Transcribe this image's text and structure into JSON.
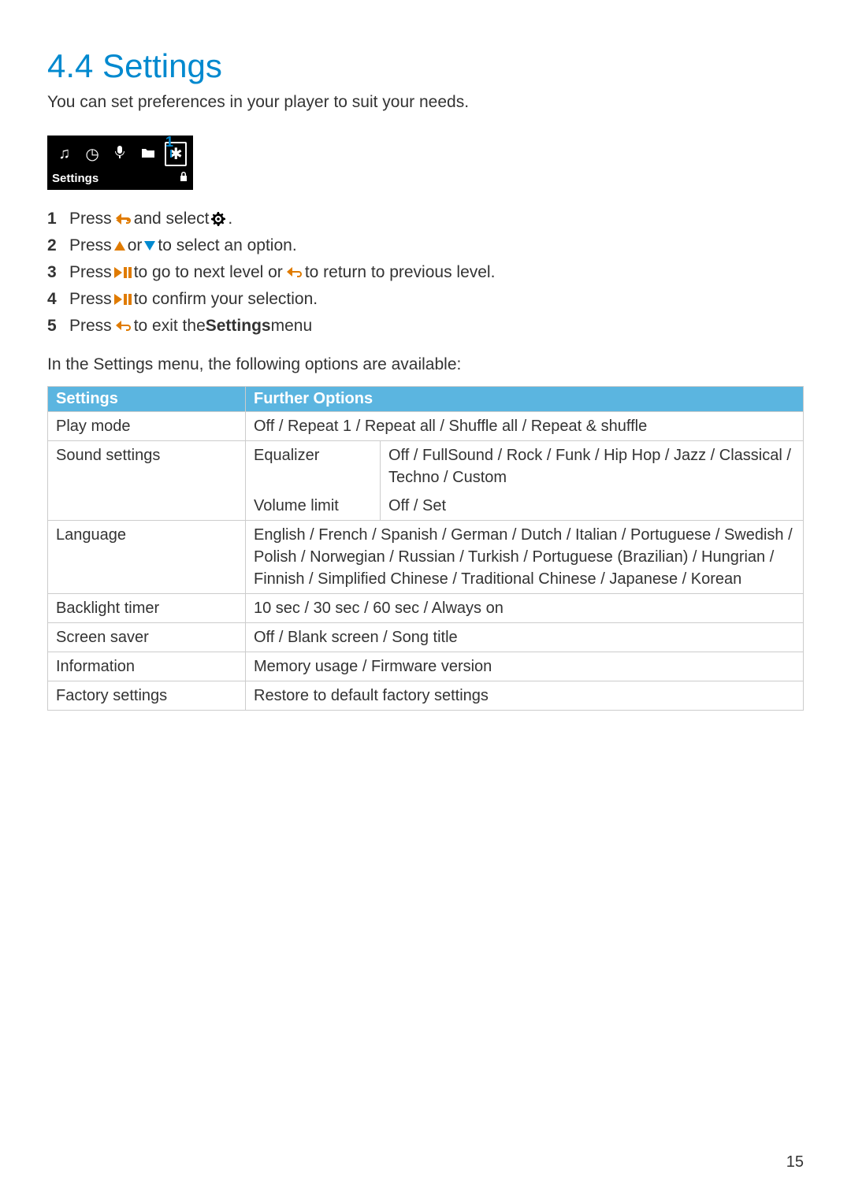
{
  "heading": "4.4  Settings",
  "intro": "You can set preferences in your player to suit your needs.",
  "figure": {
    "callout": "1",
    "icons": [
      "music-note-icon",
      "clock-icon",
      "microphone-icon",
      "folder-icon",
      "gear-icon"
    ],
    "label": "Settings",
    "lock": "lock-icon"
  },
  "steps": [
    {
      "pre": "Press ",
      "icon1": "back",
      "mid": " and select ",
      "icon2": "gear",
      "post": "."
    },
    {
      "pre": "Press ",
      "icon1": "up",
      "mid": " or ",
      "icon2": "down",
      "post": " to select an option."
    },
    {
      "pre": "Press ",
      "icon1": "playpause",
      "mid": " to go to next level or ",
      "icon2": "back",
      "post": " to return to previous level."
    },
    {
      "pre": "Press ",
      "icon1": "playpause",
      "mid": " to confirm your selection.",
      "icon2": "",
      "post": ""
    },
    {
      "pre": "Press ",
      "icon1": "back",
      "mid": " to exit the ",
      "bold": "Settings",
      "post": " menu"
    }
  ],
  "sub_intro": "In the Settings menu, the following options are available:",
  "table": {
    "headers": [
      "Settings",
      "Further Options"
    ],
    "rows": [
      {
        "setting": "Play mode",
        "sub": "",
        "opts": "Off / Repeat 1 / Repeat all / Shuffle all / Repeat & shuffle"
      },
      {
        "setting": "Sound settings",
        "sub": "Equalizer",
        "opts": "Off / FullSound / Rock / Funk / Hip Hop / Jazz / Classical / Techno / Custom"
      },
      {
        "setting": "",
        "sub": "Volume limit",
        "opts": "Off / Set"
      },
      {
        "setting": "Language",
        "sub": "",
        "opts": "English / French / Spanish / German / Dutch / Italian / Portuguese / Swedish / Polish / Norwegian / Russian / Turkish / Portuguese (Brazilian) / Hungrian / Finnish / Simplified Chinese / Traditional Chinese / Japanese / Korean"
      },
      {
        "setting": "Backlight timer",
        "sub": "",
        "opts": "10 sec / 30 sec / 60 sec / Always on"
      },
      {
        "setting": "Screen saver",
        "sub": "",
        "opts": "Off / Blank screen / Song title"
      },
      {
        "setting": "Information",
        "sub": "",
        "opts": "Memory usage / Firmware version"
      },
      {
        "setting": "Factory settings",
        "sub": "",
        "opts": "Restore to default factory settings"
      }
    ]
  },
  "page_number": "15"
}
